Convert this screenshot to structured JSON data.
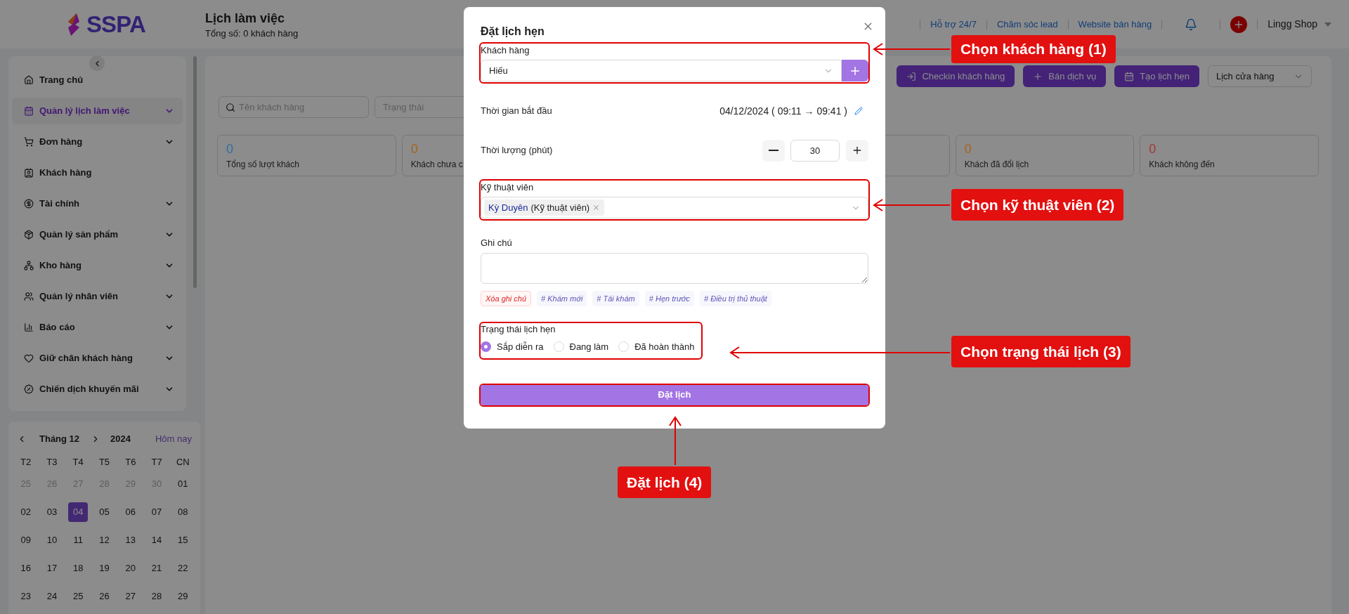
{
  "header": {
    "logo_text": "SSPA",
    "title": "Lịch làm việc",
    "subtitle": "Tổng số: 0 khách hàng",
    "links": [
      "Hỗ trợ 24/7",
      "Chăm sóc lead",
      "Website bán hàng"
    ],
    "user": "Lingg Shop"
  },
  "sidebar": {
    "items": [
      {
        "label": "Trang chủ",
        "selected": false,
        "expandable": false
      },
      {
        "label": "Quản lý lịch làm việc",
        "selected": true,
        "expandable": true
      },
      {
        "label": "Đơn hàng",
        "selected": false,
        "expandable": true
      },
      {
        "label": "Khách hàng",
        "selected": false,
        "expandable": false
      },
      {
        "label": "Tài chính",
        "selected": false,
        "expandable": true
      },
      {
        "label": "Quản lý sản phẩm",
        "selected": false,
        "expandable": true
      },
      {
        "label": "Kho hàng",
        "selected": false,
        "expandable": true
      },
      {
        "label": "Quản lý nhân viên",
        "selected": false,
        "expandable": true
      },
      {
        "label": "Báo cáo",
        "selected": false,
        "expandable": true
      },
      {
        "label": "Giữ chân khách hàng",
        "selected": false,
        "expandable": true
      },
      {
        "label": "Chiến dịch khuyến mãi",
        "selected": false,
        "expandable": true
      }
    ]
  },
  "calendar": {
    "month": "Tháng 12",
    "year": "2024",
    "today": "Hôm nay",
    "weekdays": [
      "T2",
      "T3",
      "T4",
      "T5",
      "T6",
      "T7",
      "CN"
    ],
    "days": [
      {
        "text": "25",
        "muted": true,
        "selected": false
      },
      {
        "text": "26",
        "muted": true,
        "selected": false
      },
      {
        "text": "27",
        "muted": true,
        "selected": false
      },
      {
        "text": "28",
        "muted": true,
        "selected": false
      },
      {
        "text": "29",
        "muted": true,
        "selected": false
      },
      {
        "text": "30",
        "muted": true,
        "selected": false
      },
      {
        "text": "01",
        "muted": false,
        "selected": false
      },
      {
        "text": "02",
        "muted": false,
        "selected": false
      },
      {
        "text": "03",
        "muted": false,
        "selected": false
      },
      {
        "text": "04",
        "muted": false,
        "selected": true
      },
      {
        "text": "05",
        "muted": false,
        "selected": false
      },
      {
        "text": "06",
        "muted": false,
        "selected": false
      },
      {
        "text": "07",
        "muted": false,
        "selected": false
      },
      {
        "text": "08",
        "muted": false,
        "selected": false
      },
      {
        "text": "09",
        "muted": false,
        "selected": false
      },
      {
        "text": "10",
        "muted": false,
        "selected": false
      },
      {
        "text": "11",
        "muted": false,
        "selected": false
      },
      {
        "text": "12",
        "muted": false,
        "selected": false
      },
      {
        "text": "13",
        "muted": false,
        "selected": false
      },
      {
        "text": "14",
        "muted": false,
        "selected": false
      },
      {
        "text": "15",
        "muted": false,
        "selected": false
      },
      {
        "text": "16",
        "muted": false,
        "selected": false
      },
      {
        "text": "17",
        "muted": false,
        "selected": false
      },
      {
        "text": "18",
        "muted": false,
        "selected": false
      },
      {
        "text": "19",
        "muted": false,
        "selected": false
      },
      {
        "text": "20",
        "muted": false,
        "selected": false
      },
      {
        "text": "21",
        "muted": false,
        "selected": false
      },
      {
        "text": "22",
        "muted": false,
        "selected": false
      },
      {
        "text": "23",
        "muted": false,
        "selected": false
      },
      {
        "text": "24",
        "muted": false,
        "selected": false
      },
      {
        "text": "25",
        "muted": false,
        "selected": false
      },
      {
        "text": "26",
        "muted": false,
        "selected": false
      },
      {
        "text": "27",
        "muted": false,
        "selected": false
      },
      {
        "text": "28",
        "muted": false,
        "selected": false
      },
      {
        "text": "29",
        "muted": false,
        "selected": false
      }
    ]
  },
  "toolbar": {
    "buttons": [
      "Checkin khách hàng",
      "Bán dịch vụ",
      "Tạo lịch hẹn"
    ],
    "view_select": "Lịch cửa hàng"
  },
  "filters": {
    "search": {
      "placeholder": "Tên khách hàng"
    },
    "status": {
      "placeholder": "Trạng thái"
    }
  },
  "stats": [
    {
      "value": "0",
      "label": "Tổng số lượt khách",
      "color": "#2e6ea6"
    },
    {
      "value": "0",
      "label": "Khách chưa c",
      "color": "#a8621a"
    },
    {
      "value": "0",
      "label": "Khách đã đổi lịch",
      "color": "#a8621a"
    },
    {
      "value": "0",
      "label": "Khách không đến",
      "color": "#a83232"
    }
  ],
  "modal": {
    "title": "Đặt lịch hẹn",
    "customer": {
      "label": "Khách hàng",
      "value": "Hiếu"
    },
    "start_time": {
      "label": "Thời gian bắt đầu",
      "value": "04/12/2024 ( 09:11 → 09:41 )"
    },
    "duration": {
      "label": "Thời lượng (phút)",
      "value": "30"
    },
    "technician": {
      "label": "Kỹ thuật viên",
      "tag_name": "Kỳ Duyên",
      "tag_role": "(Kỹ thuật viên)"
    },
    "note": {
      "label": "Ghi chú",
      "clear": "Xóa ghi chú",
      "tags": [
        "# Khám mới",
        "# Tái khám",
        "# Hẹn trước",
        "# Điều trị thủ thuật"
      ]
    },
    "status": {
      "label": "Trạng thái lịch hẹn",
      "options": [
        {
          "label": "Sắp diễn ra",
          "selected": true
        },
        {
          "label": "Đang làm",
          "selected": false
        },
        {
          "label": "Đã hoàn thành",
          "selected": false
        }
      ]
    },
    "submit": "Đặt lịch"
  },
  "annotations": [
    "Chọn khách hàng (1)",
    "Chọn kỹ thuật viên (2)",
    "Chọn trạng thái lịch (3)",
    "Đặt lịch (4)"
  ]
}
